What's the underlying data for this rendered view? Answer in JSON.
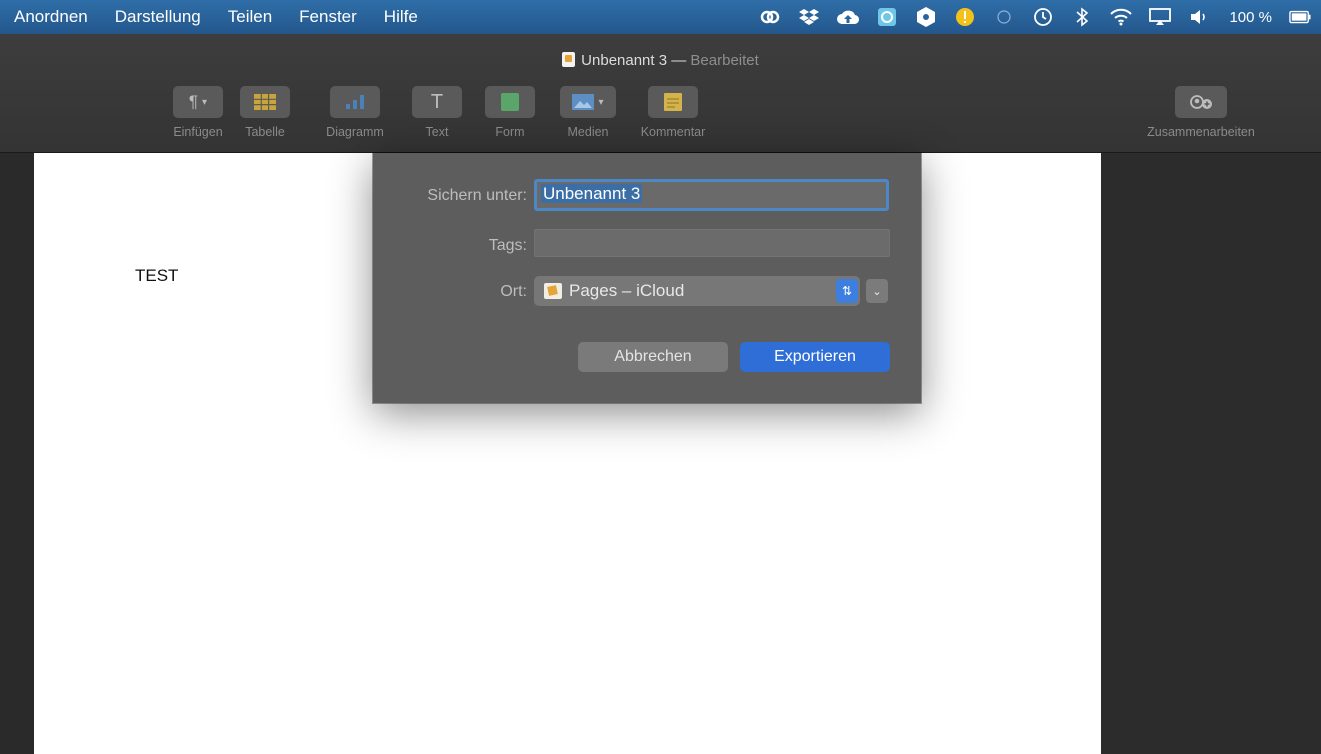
{
  "menubar": {
    "menus": [
      "Anordnen",
      "Darstellung",
      "Teilen",
      "Fenster",
      "Hilfe"
    ],
    "status_icons": [
      "creative-cloud-icon",
      "dropbox-icon",
      "cloud-upload-icon",
      "app-icon",
      "sync-icon",
      "notification-icon",
      "moon-icon",
      "time-machine-icon",
      "bluetooth-icon",
      "wifi-icon",
      "airplay-icon",
      "volume-icon"
    ],
    "battery": "100 %"
  },
  "window": {
    "title": "Unbenannt 3",
    "separator": "—",
    "status": "Bearbeitet"
  },
  "toolbar": {
    "items": [
      {
        "label": "Einfügen",
        "icon": "paragraph-icon"
      },
      {
        "label": "Tabelle",
        "icon": "table-icon"
      },
      {
        "label": "Diagramm",
        "icon": "chart-icon"
      },
      {
        "label": "Text",
        "icon": "text-icon"
      },
      {
        "label": "Form",
        "icon": "shape-icon"
      },
      {
        "label": "Medien",
        "icon": "media-icon"
      },
      {
        "label": "Kommentar",
        "icon": "comment-icon"
      }
    ],
    "collaborate_label": "Zusammenarbeiten"
  },
  "document": {
    "text": "TEST"
  },
  "export_sheet": {
    "name_label": "Sichern unter:",
    "name_value": "Unbenannt 3",
    "tags_label": "Tags:",
    "tags_value": "",
    "location_label": "Ort:",
    "location_value": "Pages – iCloud",
    "cancel_label": "Abbrechen",
    "export_label": "Exportieren"
  },
  "colors": {
    "menubar": "#2a64a0",
    "accent": "#2e6ed6",
    "page": "#ffffff"
  }
}
